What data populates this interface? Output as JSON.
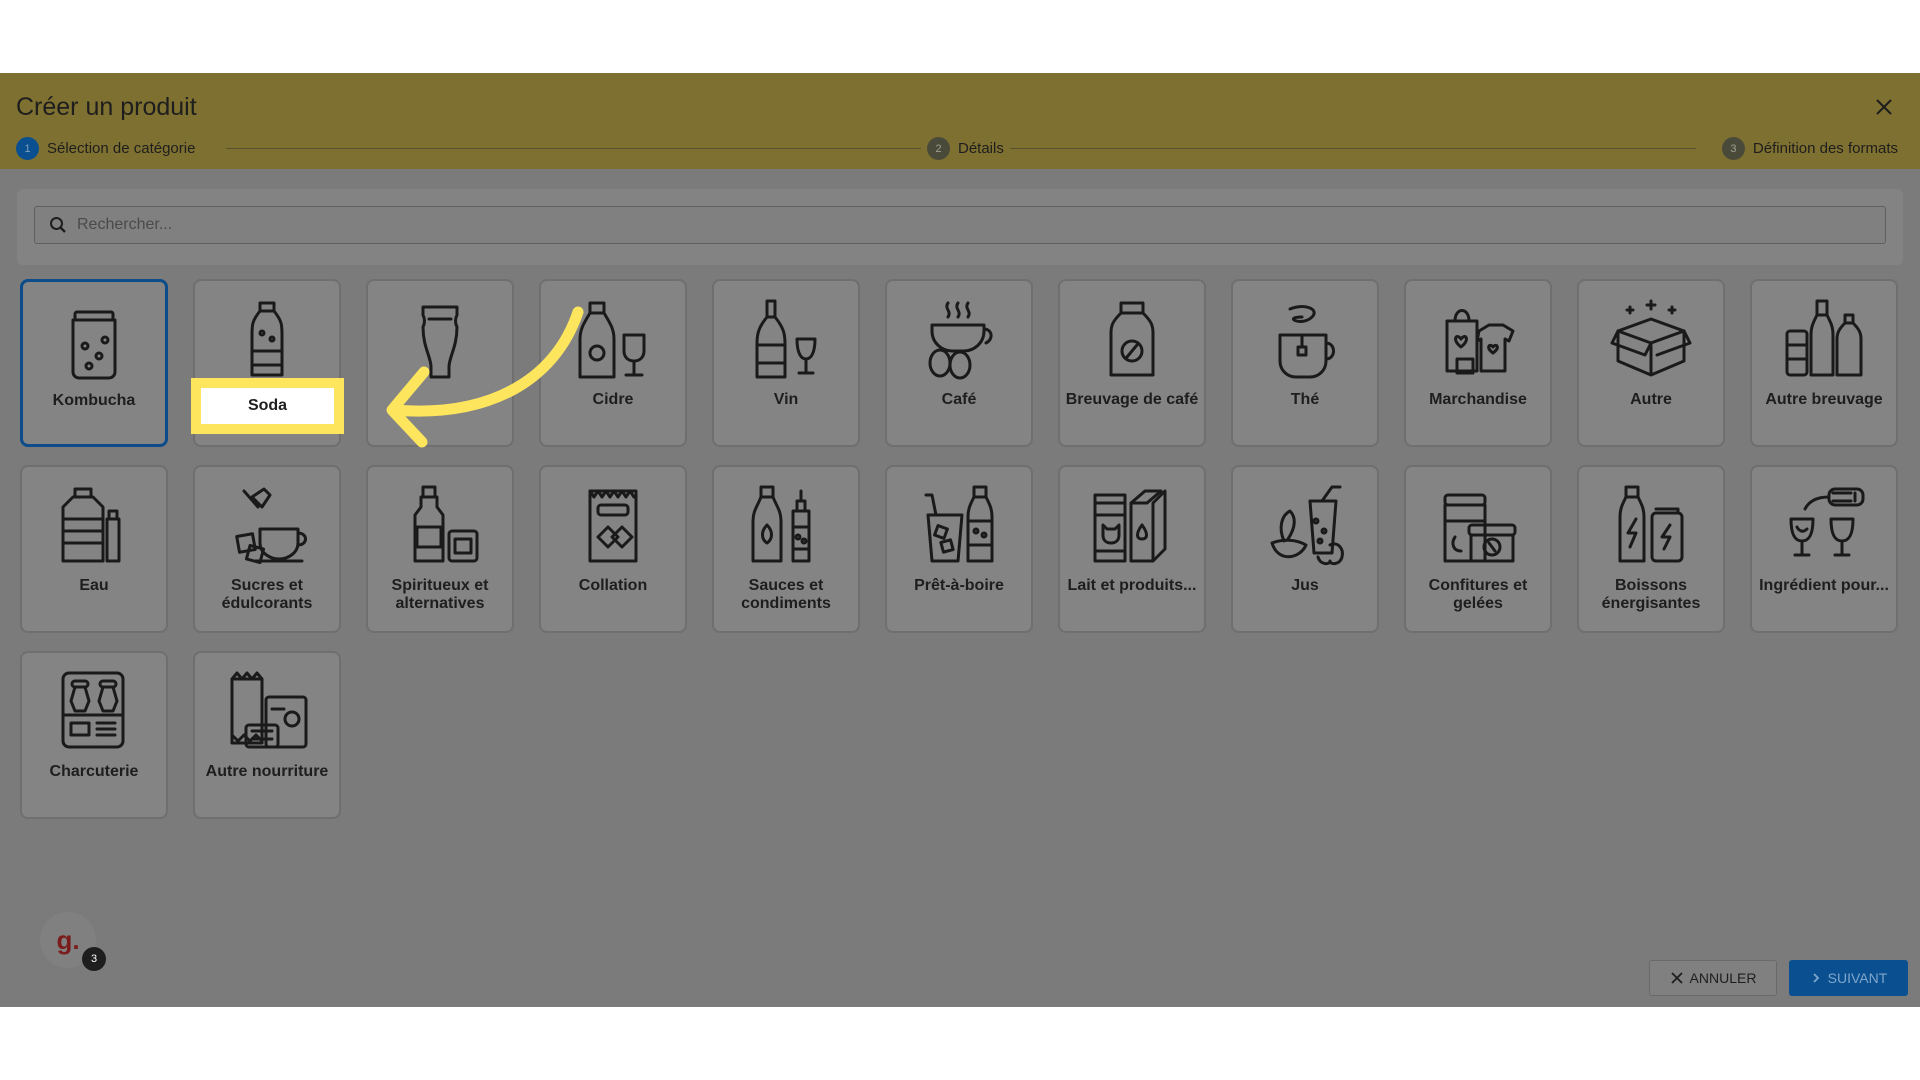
{
  "title": "Créer un produit",
  "steps": [
    {
      "num": "1",
      "label": "Sélection de catégorie"
    },
    {
      "num": "2",
      "label": "Détails"
    },
    {
      "num": "3",
      "label": "Définition des formats"
    }
  ],
  "search": {
    "placeholder": "Rechercher..."
  },
  "categories": [
    {
      "label": "Kombucha",
      "icon": "kombucha-jar-icon"
    },
    {
      "label": "Soda",
      "icon": "soda-bottle-icon"
    },
    {
      "label": "",
      "icon": "beer-glass-icon"
    },
    {
      "label": "Cidre",
      "icon": "cider-bottle-icon"
    },
    {
      "label": "Vin",
      "icon": "wine-bottle-icon"
    },
    {
      "label": "Café",
      "icon": "coffee-cup-icon"
    },
    {
      "label": "Breuvage de café",
      "icon": "coffee-drink-bottle-icon"
    },
    {
      "label": "Thé",
      "icon": "tea-cup-icon"
    },
    {
      "label": "Marchandise",
      "icon": "merchandise-icon"
    },
    {
      "label": "Autre",
      "icon": "open-box-icon"
    },
    {
      "label": "Autre breuvage",
      "icon": "other-beverage-icon"
    },
    {
      "label": "Eau",
      "icon": "water-jug-icon"
    },
    {
      "label": "Sucres et édulcorants",
      "icon": "sugar-icon"
    },
    {
      "label": "Spiritueux et alternatives",
      "icon": "spirits-bottle-icon"
    },
    {
      "label": "Collation",
      "icon": "snack-bag-icon"
    },
    {
      "label": "Sauces et condiments",
      "icon": "sauce-bottle-icon"
    },
    {
      "label": "Prêt-à-boire",
      "icon": "ready-to-drink-icon"
    },
    {
      "label": "Lait et produits...",
      "icon": "milk-products-icon"
    },
    {
      "label": "Jus",
      "icon": "juice-icon"
    },
    {
      "label": "Confitures et gelées",
      "icon": "jam-jar-icon"
    },
    {
      "label": "Boissons énergisantes",
      "icon": "energy-drink-icon"
    },
    {
      "label": "Ingrédient pour...",
      "icon": "ingredient-icon"
    },
    {
      "label": "Charcuterie",
      "icon": "charcuterie-icon"
    },
    {
      "label": "Autre nourriture",
      "icon": "other-food-icon"
    }
  ],
  "highlight_label": "Soda",
  "footer": {
    "cancel_label": "ANNULER",
    "next_label": "SUIVANT"
  },
  "avatar": {
    "letter": "g.",
    "badge_count": "3"
  },
  "colors": {
    "header": "#7e7030",
    "overlay": "#7b7b7b",
    "primary": "#0a4f8f",
    "highlight": "#fde65e"
  }
}
